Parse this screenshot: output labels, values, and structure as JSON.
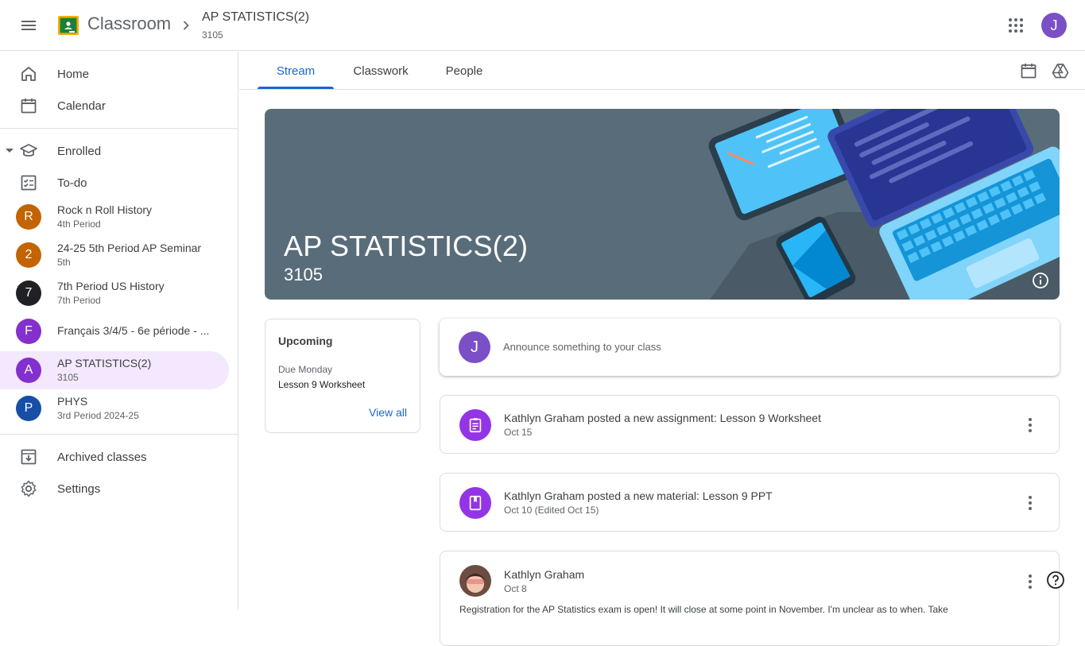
{
  "header": {
    "app_name": "Classroom",
    "crumb_title": "AP STATISTICS(2)",
    "crumb_sub": "3105",
    "user_initial": "J",
    "avatar_color": "#7b4fc6"
  },
  "sidebar": {
    "home": "Home",
    "calendar": "Calendar",
    "enrolled": "Enrolled",
    "todo": "To-do",
    "classes": [
      {
        "initial": "R",
        "name": "Rock n Roll History",
        "sub": "4th Period",
        "color": "#c26401"
      },
      {
        "initial": "2",
        "name": "24-25 5th Period AP Seminar",
        "sub": "5th",
        "color": "#c26401"
      },
      {
        "initial": "7",
        "name": "7th Period US History",
        "sub": "7th Period",
        "color": "#202124"
      },
      {
        "initial": "F",
        "name": "Français 3/4/5 - 6e période - ...",
        "sub": "",
        "color": "#8430ce"
      },
      {
        "initial": "A",
        "name": "AP STATISTICS(2)",
        "sub": "3105",
        "color": "#8430ce"
      },
      {
        "initial": "P",
        "name": "PHYS",
        "sub": "3rd Period 2024-25",
        "color": "#174ea6"
      }
    ],
    "archived": "Archived classes",
    "settings": "Settings"
  },
  "tabs": [
    {
      "label": "Stream"
    },
    {
      "label": "Classwork"
    },
    {
      "label": "People"
    }
  ],
  "banner": {
    "title": "AP STATISTICS(2)",
    "subtitle": "3105"
  },
  "upcoming": {
    "title": "Upcoming",
    "due": "Due Monday",
    "item": "Lesson 9 Worksheet",
    "view_all": "View all"
  },
  "announce": {
    "initial": "J",
    "placeholder": "Announce something to your class"
  },
  "posts": [
    {
      "title": "Kathlyn Graham posted a new assignment: Lesson 9 Worksheet",
      "date": "Oct 15",
      "icon": "assignment-icon"
    },
    {
      "title": "Kathlyn Graham posted a new material: Lesson 9 PPT",
      "date": "Oct 10 (Edited Oct 15)",
      "icon": "material-icon"
    }
  ],
  "post3": {
    "author": "Kathlyn Graham",
    "date": "Oct 8",
    "body": "Registration for the AP Statistics exam is open! It will close at some point in November.  I'm unclear as to when. Take"
  }
}
